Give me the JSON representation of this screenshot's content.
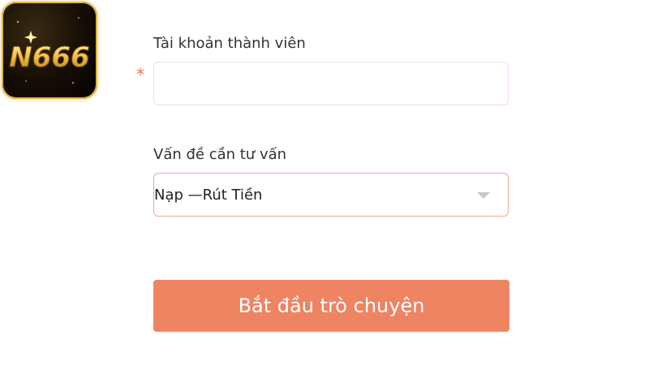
{
  "brand": {
    "logo_text": "N666",
    "accent_color": "#ee8462",
    "logo_gold": "#e8b53a"
  },
  "form": {
    "account_label": "Tài khoản thành viên",
    "required_mark": "*",
    "account_value": "",
    "topic_label": "Vấn đề cần tư vấn",
    "topic_selected": "Nạp —Rút Tiền",
    "submit_label": "Bắt đầu trò chuyện"
  },
  "icons": {
    "dropdown": "chevron-down-icon",
    "required": "asterisk-icon"
  }
}
